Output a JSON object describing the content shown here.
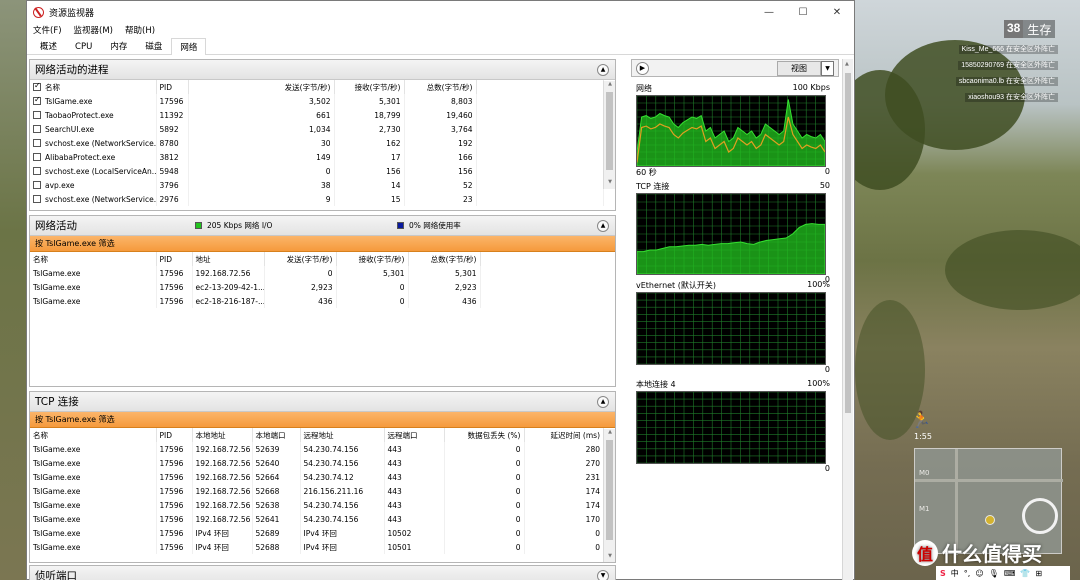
{
  "window": {
    "title": "资源监视器",
    "controls": [
      "—",
      "☐",
      "✕"
    ]
  },
  "menu": [
    "文件(F)",
    "监视器(M)",
    "帮助(H)"
  ],
  "tabs": [
    "概述",
    "CPU",
    "内存",
    "磁盘",
    "网络"
  ],
  "active_tab": "网络",
  "processes_panel": {
    "title": "网络活动的进程",
    "columns": [
      "名称",
      "PID",
      "发送(字节/秒)",
      "接收(字节/秒)",
      "总数(字节/秒)"
    ],
    "rows": [
      {
        "name": "TslGame.exe",
        "pid": "17596",
        "send": "3,502",
        "recv": "5,301",
        "total": "8,803",
        "checked": true
      },
      {
        "name": "TaobaoProtect.exe",
        "pid": "11392",
        "send": "661",
        "recv": "18,799",
        "total": "19,460",
        "checked": false
      },
      {
        "name": "SearchUI.exe",
        "pid": "5892",
        "send": "1,034",
        "recv": "2,730",
        "total": "3,764",
        "checked": false
      },
      {
        "name": "svchost.exe (NetworkService...",
        "pid": "8780",
        "send": "30",
        "recv": "162",
        "total": "192",
        "checked": false
      },
      {
        "name": "AlibabaProtect.exe",
        "pid": "3812",
        "send": "149",
        "recv": "17",
        "total": "166",
        "checked": false
      },
      {
        "name": "svchost.exe (LocalServiceAn...",
        "pid": "5948",
        "send": "0",
        "recv": "156",
        "total": "156",
        "checked": false
      },
      {
        "name": "avp.exe",
        "pid": "3796",
        "send": "38",
        "recv": "14",
        "total": "52",
        "checked": false
      },
      {
        "name": "svchost.exe (NetworkService...",
        "pid": "2976",
        "send": "9",
        "recv": "15",
        "total": "23",
        "checked": false
      }
    ]
  },
  "activity_panel": {
    "title": "网络活动",
    "legend_io": "205 Kbps 网络 I/O",
    "legend_usage": "0% 网络使用率",
    "io_color": "#22c41f",
    "usage_color": "#0a1a9e",
    "filter": "按 TslGame.exe 筛选",
    "columns": [
      "名称",
      "PID",
      "地址",
      "发送(字节/秒)",
      "接收(字节/秒)",
      "总数(字节/秒)"
    ],
    "rows": [
      {
        "name": "TslGame.exe",
        "pid": "17596",
        "addr": "192.168.72.56",
        "send": "0",
        "recv": "5,301",
        "total": "5,301"
      },
      {
        "name": "TslGame.exe",
        "pid": "17596",
        "addr": "ec2-13-209-42-1...",
        "send": "2,923",
        "recv": "0",
        "total": "2,923"
      },
      {
        "name": "TslGame.exe",
        "pid": "17596",
        "addr": "ec2-18-216-187-...",
        "send": "436",
        "recv": "0",
        "total": "436"
      }
    ]
  },
  "tcp_panel": {
    "title": "TCP 连接",
    "filter": "按 TslGame.exe 筛选",
    "columns": [
      "名称",
      "PID",
      "本地地址",
      "本地端口",
      "远程地址",
      "远程端口",
      "数据包丢失 (%)",
      "延迟时间 (ms)"
    ],
    "rows": [
      {
        "name": "TslGame.exe",
        "pid": "17596",
        "laddr": "192.168.72.56",
        "lport": "52639",
        "raddr": "54.230.74.156",
        "rport": "443",
        "loss": "0",
        "latency": "280"
      },
      {
        "name": "TslGame.exe",
        "pid": "17596",
        "laddr": "192.168.72.56",
        "lport": "52640",
        "raddr": "54.230.74.156",
        "rport": "443",
        "loss": "0",
        "latency": "270"
      },
      {
        "name": "TslGame.exe",
        "pid": "17596",
        "laddr": "192.168.72.56",
        "lport": "52664",
        "raddr": "54.230.74.12",
        "rport": "443",
        "loss": "0",
        "latency": "231"
      },
      {
        "name": "TslGame.exe",
        "pid": "17596",
        "laddr": "192.168.72.56",
        "lport": "52668",
        "raddr": "216.156.211.16",
        "rport": "443",
        "loss": "0",
        "latency": "174"
      },
      {
        "name": "TslGame.exe",
        "pid": "17596",
        "laddr": "192.168.72.56",
        "lport": "52638",
        "raddr": "54.230.74.156",
        "rport": "443",
        "loss": "0",
        "latency": "174"
      },
      {
        "name": "TslGame.exe",
        "pid": "17596",
        "laddr": "192.168.72.56",
        "lport": "52641",
        "raddr": "54.230.74.156",
        "rport": "443",
        "loss": "0",
        "latency": "170"
      },
      {
        "name": "TslGame.exe",
        "pid": "17596",
        "laddr": "IPv4 环回",
        "lport": "52689",
        "raddr": "IPv4 环回",
        "rport": "10502",
        "loss": "0",
        "latency": "0"
      },
      {
        "name": "TslGame.exe",
        "pid": "17596",
        "laddr": "IPv4 环回",
        "lport": "52688",
        "raddr": "IPv4 环回",
        "rport": "10501",
        "loss": "0",
        "latency": "0"
      }
    ]
  },
  "listen_panel": {
    "title": "侦听端口"
  },
  "graphs": {
    "view_label": "视图",
    "network": {
      "label": "网络",
      "max": "100 Kbps",
      "foot_left": "60 秒",
      "foot_right": "0"
    },
    "tcp": {
      "label": "TCP 连接",
      "max": "50",
      "foot_right": "0"
    },
    "vethernet": {
      "label": "vEthernet (默认开关)",
      "max": "100%",
      "foot_right": "0"
    },
    "local": {
      "label": "本地连接 4",
      "max": "100%",
      "foot_right": "0"
    }
  },
  "game_hud": {
    "alive_count": "38",
    "alive_label": "生存",
    "kill_feed": [
      "Kiss_Me_666 在安全区外阵亡",
      "15850290769 在安全区外阵亡",
      "sbcaonima0.lb 在安全区外阵亡",
      "xiaoshou93 在安全区外阵亡"
    ],
    "timer": "1:55",
    "map_markers": [
      "M0",
      "M1"
    ],
    "watermark": "什么值得买",
    "watermark_logo": "值",
    "ime": [
      "S",
      "中",
      "°,",
      "☺",
      "🎙",
      "⌨",
      "👕",
      "⊞"
    ]
  }
}
